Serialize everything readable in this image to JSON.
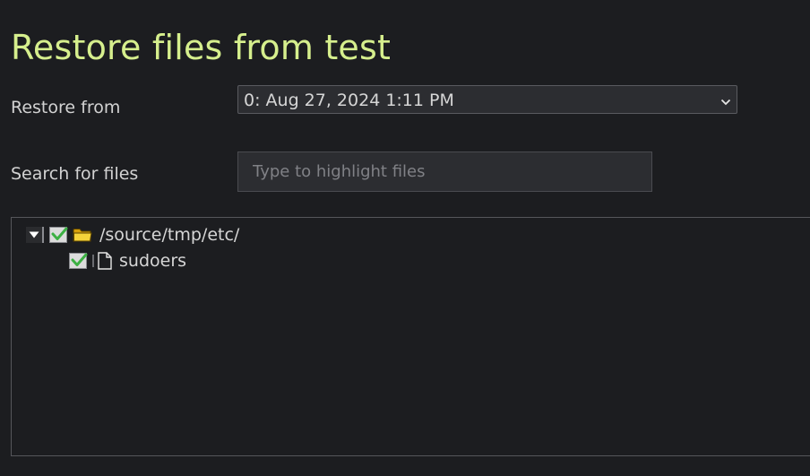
{
  "page": {
    "title": "Restore files from test"
  },
  "restore": {
    "label": "Restore from",
    "selected": "0: Aug 27, 2024 1:11 PM"
  },
  "search": {
    "label": "Search for files",
    "placeholder": "Type to highlight files",
    "value": ""
  },
  "tree": {
    "root": {
      "label": "/source/tmp/etc/",
      "expanded": true,
      "checked": true,
      "icon": "folder-icon"
    },
    "children": [
      {
        "label": "sudoers",
        "checked": true,
        "icon": "file-icon"
      }
    ]
  },
  "colors": {
    "title": "#d6ef8d",
    "background": "#1c1d20",
    "check": "#3cb043"
  }
}
